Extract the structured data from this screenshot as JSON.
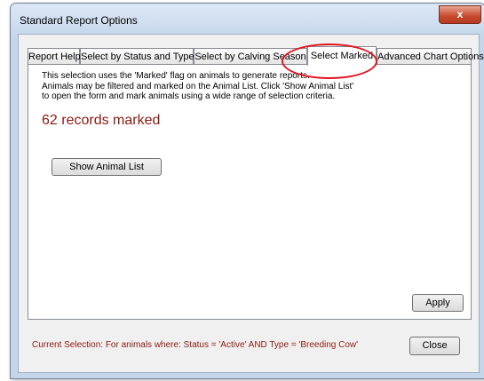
{
  "window": {
    "title": "Standard Report Options",
    "close_glyph": "x"
  },
  "tabs": [
    {
      "label": "Report Help"
    },
    {
      "label": "Select by Status and Type"
    },
    {
      "label": "Select by Calving Season"
    },
    {
      "label": "Select Marked",
      "active": true
    },
    {
      "label": "Advanced Chart Options"
    }
  ],
  "panel": {
    "description": [
      "This selection uses the 'Marked' flag on animals to generate reports.",
      "Animals may be filtered and marked on the Animal List. Click 'Show Animal List'",
      "to open the form and mark animals using a wide range of selection criteria."
    ],
    "records_marked": "62 records marked",
    "show_list_label": "Show Animal List",
    "apply_label": "Apply"
  },
  "footer": {
    "current_selection": "Current Selection: For animals where:  Status = 'Active' AND Type = 'Breeding Cow'",
    "close_label": "Close"
  },
  "colors": {
    "accent_text": "#8b1a10",
    "annotation_circle": "#e0141e"
  }
}
